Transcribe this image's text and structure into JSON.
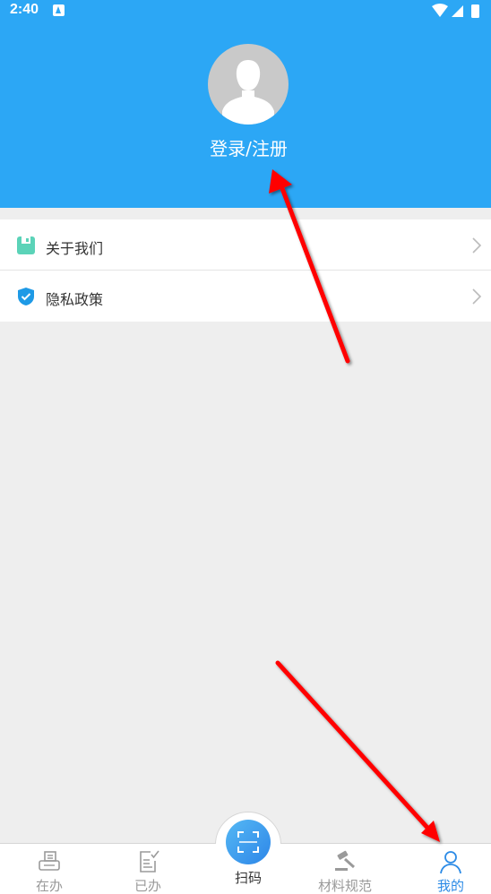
{
  "status_bar": {
    "time": "2:40"
  },
  "profile": {
    "login_label": "登录/注册"
  },
  "menu": {
    "items": [
      {
        "label": "关于我们",
        "icon": "about-icon"
      },
      {
        "label": "隐私政策",
        "icon": "shield-icon"
      }
    ]
  },
  "tabbar": {
    "tabs": [
      {
        "label": "在办",
        "icon": "printer-icon"
      },
      {
        "label": "已办",
        "icon": "document-check-icon"
      },
      {
        "label": "扫码",
        "icon": "scan-icon"
      },
      {
        "label": "材料规范",
        "icon": "gavel-icon"
      },
      {
        "label": "我的",
        "icon": "user-icon"
      }
    ],
    "active_tab": "我的"
  },
  "colors": {
    "header": "#2ca7f5",
    "active": "#2c8be6",
    "arrow": "#ff0000"
  }
}
